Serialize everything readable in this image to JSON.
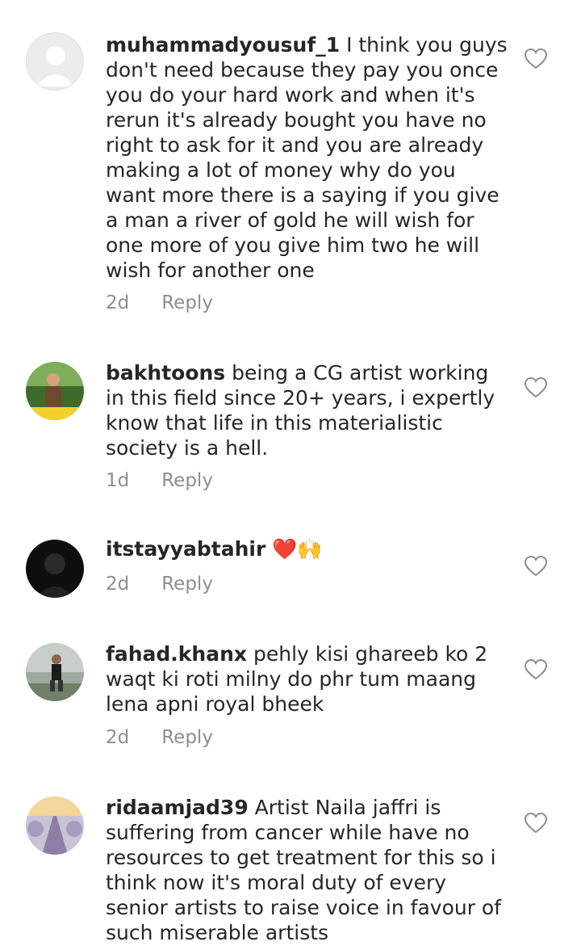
{
  "comments": [
    {
      "username": "muhammadyousuf_1",
      "text": "I think you guys don't need because they pay you once you do your hard work and when it's rerun it's already bought you have no right to ask for it and you are already making a lot of money why do you want more there is a saying if you give a man a river of gold he will wish for one more of you give him two he will wish for another one",
      "time": "2d",
      "reply": "Reply"
    },
    {
      "username": "bakhtoons",
      "text": "being a CG artist working in this field since 20+ years, i expertly know that life in this materialistic society is a hell.",
      "time": "1d",
      "reply": "Reply"
    },
    {
      "username": "itstayyabtahir",
      "text": "❤️🙌",
      "time": "2d",
      "reply": "Reply"
    },
    {
      "username": "fahad.khanx",
      "text": "pehly kisi ghareeb ko 2 waqt ki roti milny do phr tum maang lena apni royal bheek",
      "time": "2d",
      "reply": "Reply"
    },
    {
      "username": "ridaamjad39",
      "text": "Artist Naila jaffri is suffering from cancer while have no resources to get treatment for this so i think now it's moral duty of every senior artists to raise voice in favour of such miserable artists",
      "time": "",
      "reply": ""
    }
  ],
  "icons": {
    "like": "heart-outline-icon"
  },
  "colors": {
    "text": "#262626",
    "meta": "#8e8e8e"
  }
}
